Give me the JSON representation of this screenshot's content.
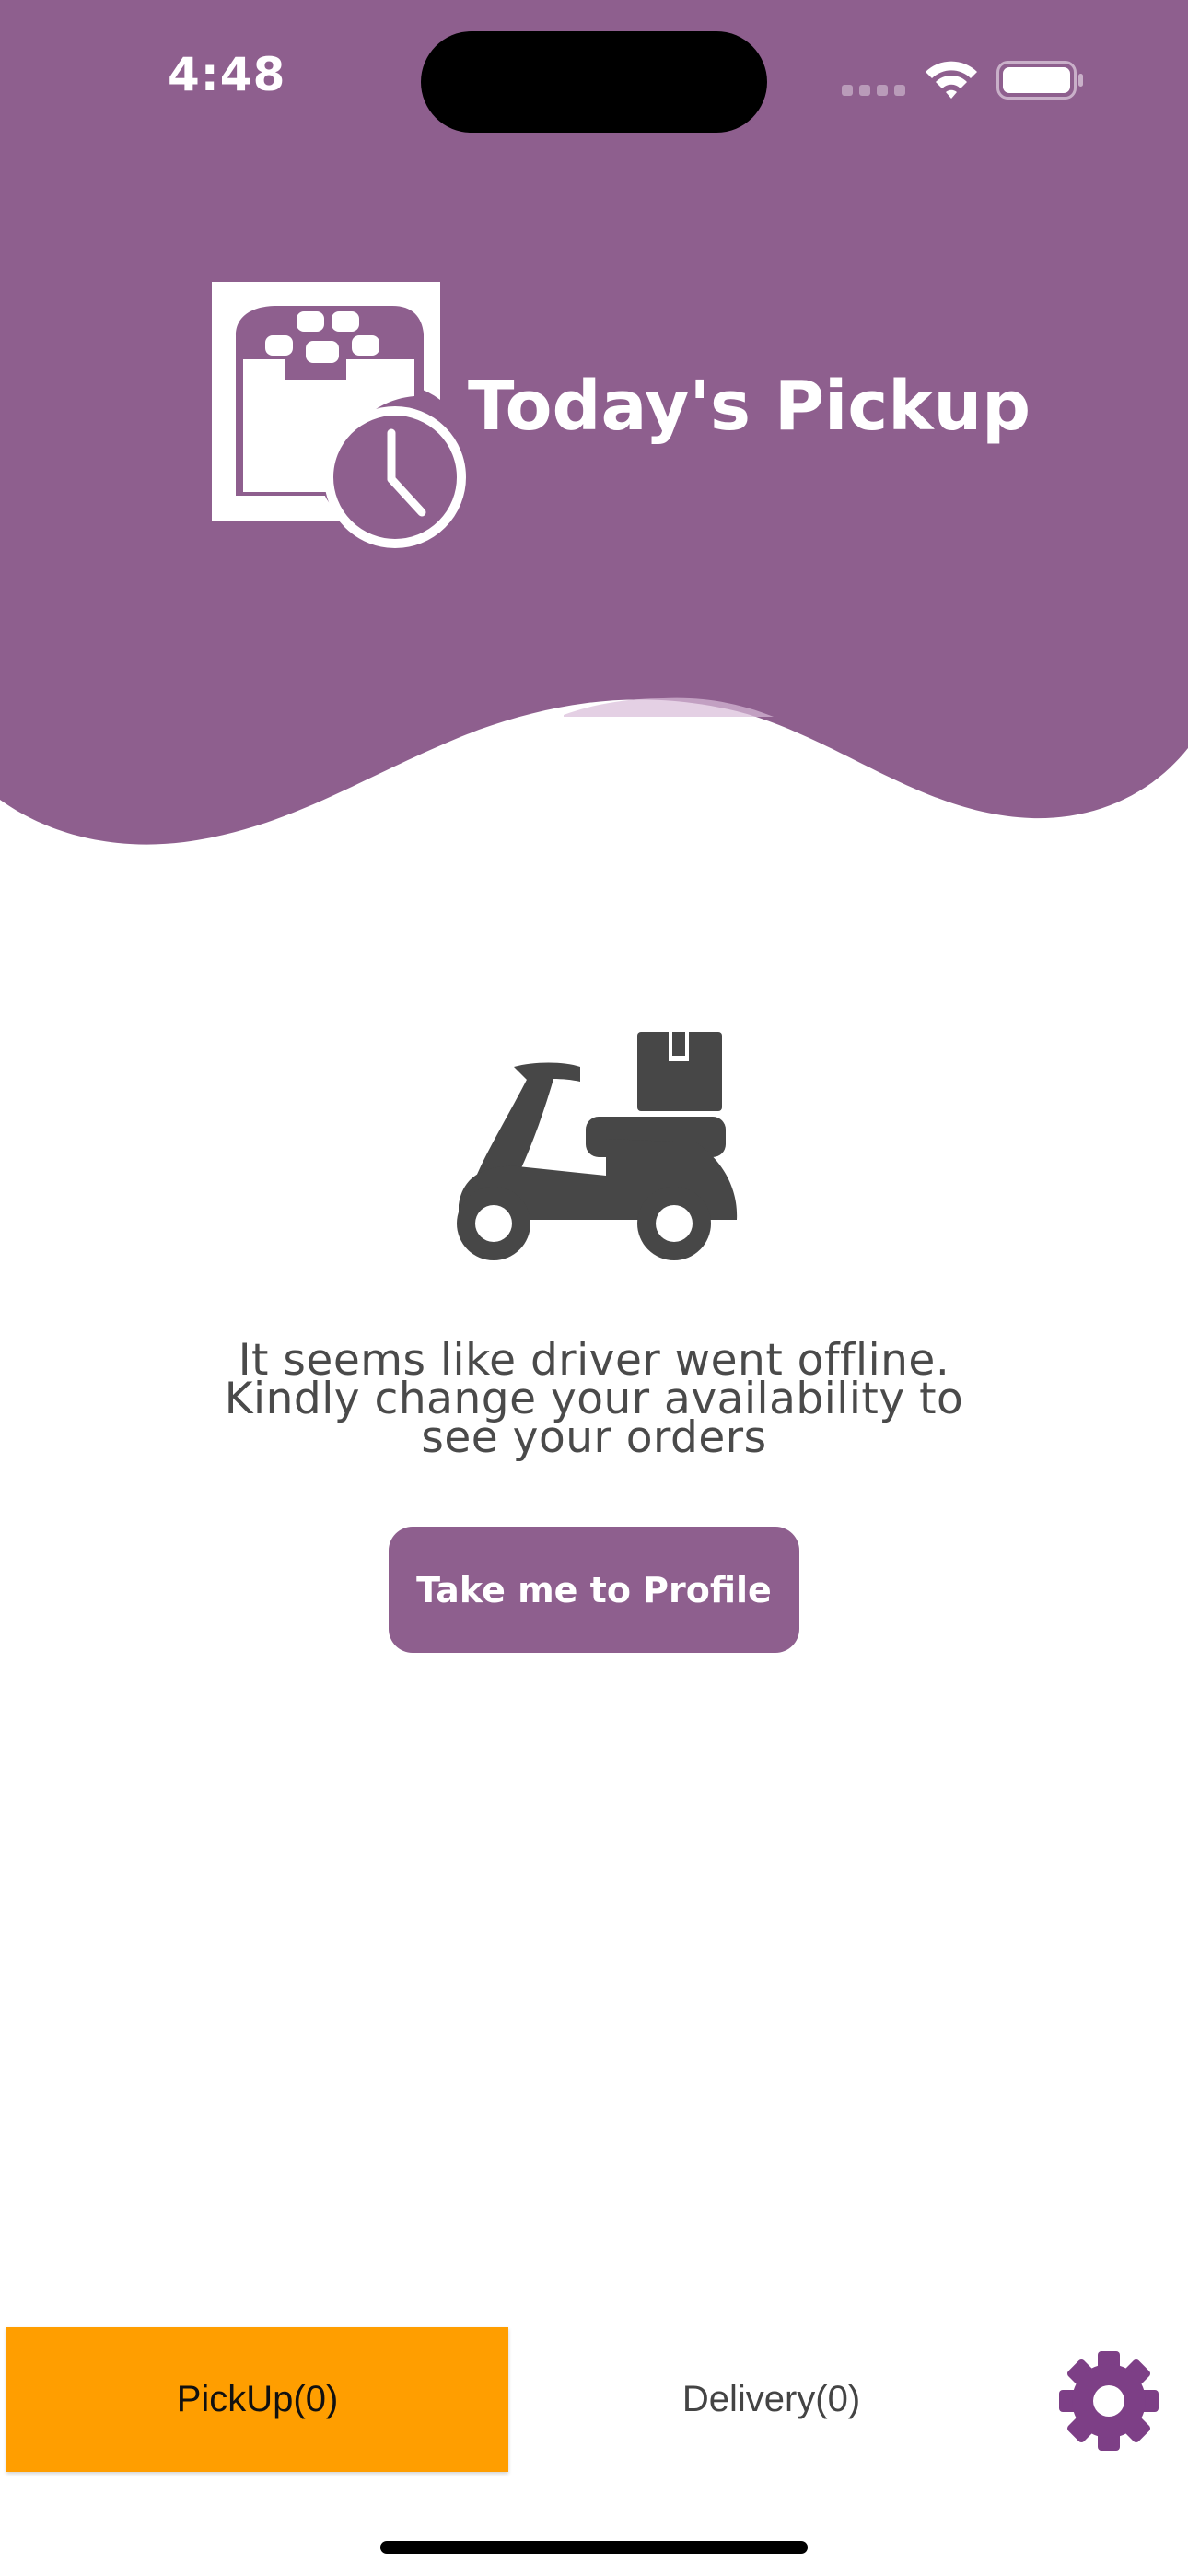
{
  "status_bar": {
    "time": "4:48"
  },
  "header": {
    "title": "Today's Pickup",
    "logo_icon": "calendar-clock-icon",
    "background_color": "#8e5f8e"
  },
  "empty_state": {
    "illustration_icon": "delivery-scooter-icon",
    "message": "It seems like driver went offline. Kindly change your availability to see your orders",
    "button_label": "Take me to Profile",
    "button_color": "#8e5f8e"
  },
  "tab_bar": {
    "tabs": [
      {
        "label": "PickUp(0)",
        "active": true,
        "active_color": "#ff9e00"
      },
      {
        "label": "Delivery(0)",
        "active": false
      }
    ],
    "settings_icon": "gear-icon",
    "settings_color": "#7d3f86"
  }
}
